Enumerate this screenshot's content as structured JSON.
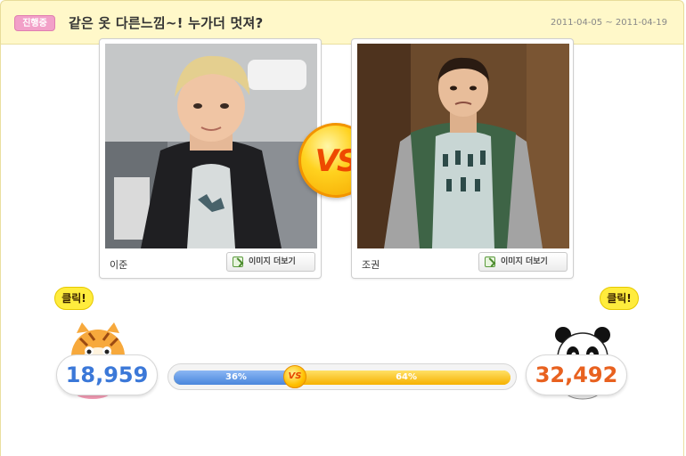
{
  "event": {
    "status": "진행중",
    "title": "같은 옷 다른느낌~! 누가더 멋져?",
    "date_range": "2011-04-05 ~ 2011-04-19"
  },
  "contestants": [
    {
      "name": "이준",
      "more_images_label": "이미지 더보기",
      "votes": "18,959",
      "percent": 36,
      "percent_label": "36%",
      "accent": "#3b78d8"
    },
    {
      "name": "조권",
      "more_images_label": "이미지 더보기",
      "votes": "32,492",
      "percent": 64,
      "percent_label": "64%",
      "accent": "#e8611f"
    }
  ],
  "vs_label": "VS",
  "vote_bubble": "클릭!",
  "colors": {
    "header_bg": "#fff8c9",
    "badge": "#f2a0c8",
    "left_bar": "#4a86dc",
    "right_bar": "#f6b100"
  },
  "icons": {
    "more_button": "image-more-icon",
    "left_mascot": "tiger-boxing-icon",
    "right_mascot": "panda-boxing-icon"
  }
}
